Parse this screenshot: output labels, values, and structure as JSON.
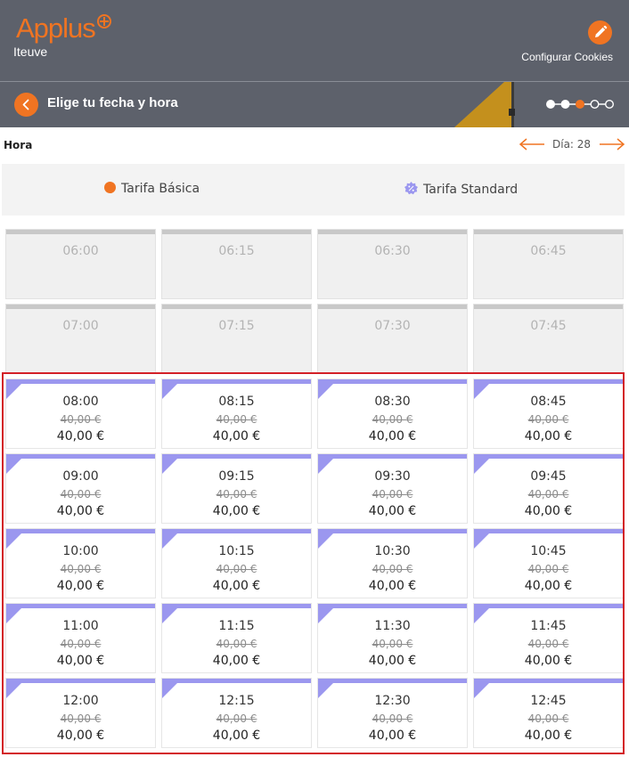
{
  "brand": {
    "logo_text": "Applus",
    "sub_brand": "Iteuve",
    "accent": "#f07422"
  },
  "header": {
    "cookies_label": "Configurar Cookies",
    "edit_icon": "pencil-icon"
  },
  "step": {
    "title": "Elige tu fecha y hora",
    "back_icon": "chevron-left-icon",
    "total_steps": 5,
    "current_step": 3
  },
  "toolbar": {
    "hora_label": "Hora",
    "day_label": "Día: 28"
  },
  "legend": {
    "basic_label": "Tarifa Básica",
    "standard_label": "Tarifa Standard",
    "basic_color": "#f07422",
    "standard_color": "#9b97ef"
  },
  "slots": [
    {
      "time": "06:00",
      "available": false
    },
    {
      "time": "06:15",
      "available": false
    },
    {
      "time": "06:30",
      "available": false
    },
    {
      "time": "06:45",
      "available": false
    },
    {
      "time": "07:00",
      "available": false
    },
    {
      "time": "07:15",
      "available": false
    },
    {
      "time": "07:30",
      "available": false
    },
    {
      "time": "07:45",
      "available": false
    },
    {
      "time": "08:00",
      "available": true,
      "old_price": "40,00 €",
      "price": "40,00 €"
    },
    {
      "time": "08:15",
      "available": true,
      "old_price": "40,00 €",
      "price": "40,00 €"
    },
    {
      "time": "08:30",
      "available": true,
      "old_price": "40,00 €",
      "price": "40,00 €"
    },
    {
      "time": "08:45",
      "available": true,
      "old_price": "40,00 €",
      "price": "40,00 €"
    },
    {
      "time": "09:00",
      "available": true,
      "old_price": "40,00 €",
      "price": "40,00 €"
    },
    {
      "time": "09:15",
      "available": true,
      "old_price": "40,00 €",
      "price": "40,00 €"
    },
    {
      "time": "09:30",
      "available": true,
      "old_price": "40,00 €",
      "price": "40,00 €"
    },
    {
      "time": "09:45",
      "available": true,
      "old_price": "40,00 €",
      "price": "40,00 €"
    },
    {
      "time": "10:00",
      "available": true,
      "old_price": "40,00 €",
      "price": "40,00 €"
    },
    {
      "time": "10:15",
      "available": true,
      "old_price": "40,00 €",
      "price": "40,00 €"
    },
    {
      "time": "10:30",
      "available": true,
      "old_price": "40,00 €",
      "price": "40,00 €"
    },
    {
      "time": "10:45",
      "available": true,
      "old_price": "40,00 €",
      "price": "40,00 €"
    },
    {
      "time": "11:00",
      "available": true,
      "old_price": "40,00 €",
      "price": "40,00 €"
    },
    {
      "time": "11:15",
      "available": true,
      "old_price": "40,00 €",
      "price": "40,00 €"
    },
    {
      "time": "11:30",
      "available": true,
      "old_price": "40,00 €",
      "price": "40,00 €"
    },
    {
      "time": "11:45",
      "available": true,
      "old_price": "40,00 €",
      "price": "40,00 €"
    },
    {
      "time": "12:00",
      "available": true,
      "old_price": "40,00 €",
      "price": "40,00 €"
    },
    {
      "time": "12:15",
      "available": true,
      "old_price": "40,00 €",
      "price": "40,00 €"
    },
    {
      "time": "12:30",
      "available": true,
      "old_price": "40,00 €",
      "price": "40,00 €"
    },
    {
      "time": "12:45",
      "available": true,
      "old_price": "40,00 €",
      "price": "40,00 €"
    }
  ]
}
